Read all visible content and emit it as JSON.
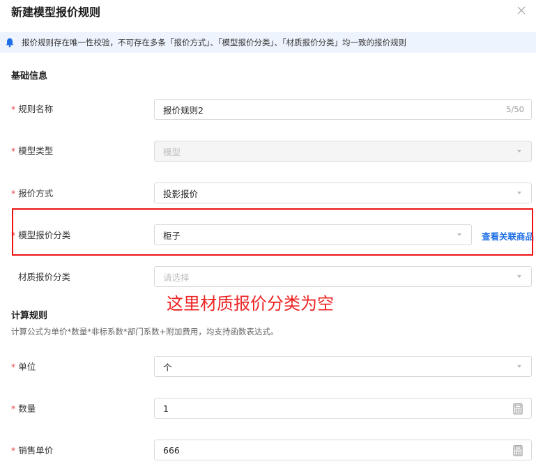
{
  "dialog": {
    "title": "新建模型报价规则",
    "close_icon": "close-icon"
  },
  "notice": {
    "icon": "bell-icon",
    "text": "报价规则存在唯一性校验，不可存在多条「报价方式」、「模型报价分类」、「材质报价分类」均一致的报价规则"
  },
  "basic": {
    "section_title": "基础信息",
    "rule_name": {
      "required": "*",
      "label": "规则名称",
      "value": "报价规则2",
      "count": "5/50"
    },
    "model_type": {
      "required": "*",
      "label": "模型类型",
      "value": "模型",
      "disabled": true
    },
    "quote_method": {
      "required": "*",
      "label": "报价方式",
      "value": "投影报价"
    },
    "model_category": {
      "required": "*",
      "label": "模型报价分类",
      "value": "柜子",
      "link": "查看关联商品"
    },
    "material_category": {
      "label": "材质报价分类",
      "placeholder": "请选择"
    }
  },
  "annotation": {
    "text": "这里材质报价分类为空",
    "color": "#ee2222"
  },
  "calc": {
    "section_title": "计算规则",
    "description": "计算公式为单价*数量*非标系数*部门系数+附加费用，均支持函数表达式。",
    "unit": {
      "required": "*",
      "label": "单位",
      "value": "个"
    },
    "quantity": {
      "required": "*",
      "label": "数量",
      "value": "1",
      "icon": "calculator-icon"
    },
    "sale_price": {
      "required": "*",
      "label": "销售单价",
      "value": "666",
      "icon": "calculator-icon"
    }
  },
  "colors": {
    "accent": "#1f6fe5",
    "required": "#e5484d",
    "notice_bg": "#eef4fd",
    "highlight": "#ee1111"
  }
}
